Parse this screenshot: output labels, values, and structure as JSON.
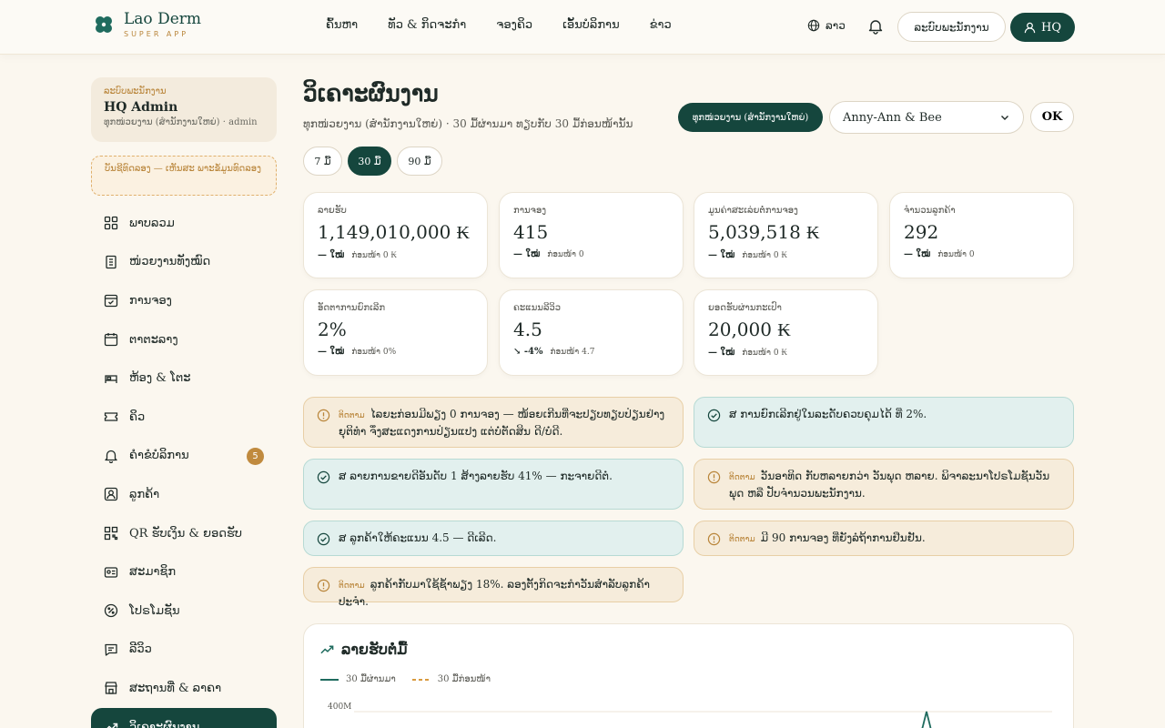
{
  "header": {
    "logo_name": "Lao Derm",
    "logo_sub": "SUPER APP",
    "nav": [
      "ຄົ້ນຫາ",
      "ທັວ & ກິດຈະກຳ",
      "ຈອງຄິວ",
      "ເອັ້ນບໍລິການ",
      "ຂ່າວ"
    ],
    "lang": "ລາວ",
    "staff_btn": "ລະບົບພະນັກງານ",
    "hq_btn": "HQ"
  },
  "sidebar": {
    "role": "ລະບົບພະນັກງານ",
    "name": "HQ Admin",
    "meta": "ທຸກໜ່ວຍງານ (ສຳນັກງານໃຫຍ່) · admin",
    "note": "ບັນຊີທົດລອງ — ເຫັນສະ ພາະຂໍ້ມູນທົດລອງ",
    "items": [
      {
        "label": "ພາບລວມ",
        "icon": "grid-icon"
      },
      {
        "label": "ໜ່ວຍງານທັງໝົດ",
        "icon": "building-icon"
      },
      {
        "label": "ການຈອງ",
        "icon": "calendar-check-icon"
      },
      {
        "label": "ຕາຕະລາງ",
        "icon": "calendar-icon"
      },
      {
        "label": "ຫ້ອງ & ໂຕະ",
        "icon": "bed-icon"
      },
      {
        "label": "ຄິວ",
        "icon": "ticket-icon"
      },
      {
        "label": "ຄຳຂໍບໍລິການ",
        "icon": "bell-icon",
        "badge": "5"
      },
      {
        "label": "ລູກຄ້າ",
        "icon": "user-square-icon"
      },
      {
        "label": "QR ຮັບເງິນ & ຍອດຮັບ",
        "icon": "qr-icon"
      },
      {
        "label": "ສະມາຊິກ",
        "icon": "id-card-icon"
      },
      {
        "label": "ໂປຣໂມຊັນ",
        "icon": "percent-icon"
      },
      {
        "label": "ລີວິວ",
        "icon": "message-icon"
      },
      {
        "label": "ສະຖານທີ່ & ລາຄາ",
        "icon": "store-icon"
      },
      {
        "label": "ວິເຄາະຜົນງານ",
        "icon": "trend-icon",
        "active": true
      }
    ]
  },
  "main": {
    "title": "ວິເຄາະຜົນງານ",
    "subtitle": "ທຸກໜ່ວຍງານ (ສຳນັກງານໃຫຍ່) · 30 ມື້ຜ່ານມາ ທຽບກັບ 30 ມື້ກ່ອນໜ້ານັ້ນ",
    "scope_pill": "ທຸກໜ່ວຍງານ (ສຳນັກງານໃຫຍ່)",
    "select_value": "Anny-Ann & Bee",
    "ok": "OK",
    "ranges": [
      "7 ມື້",
      "30 ມື້",
      "90 ມື້"
    ],
    "kpis": [
      {
        "label": "ລາຍຮັບ",
        "value": "1,149,010,000 ₭",
        "delta": "— ໃໝ່",
        "prev": "ກ່ອນໜ້າ 0 ₭"
      },
      {
        "label": "ການຈອງ",
        "value": "415",
        "delta": "— ໃໝ່",
        "prev": "ກ່ອນໜ້າ 0"
      },
      {
        "label": "ມູນຄ່າສະເລ່ຍຕໍ່ການຈອງ",
        "value": "5,039,518 ₭",
        "delta": "— ໃໝ່",
        "prev": "ກ່ອນໜ້າ 0 ₭"
      },
      {
        "label": "ຈຳນວນລູກຄ້າ",
        "value": "292",
        "delta": "— ໃໝ່",
        "prev": "ກ່ອນໜ້າ 0"
      },
      {
        "label": "ອັດຕາການຍົກເລີກ",
        "value": "2%",
        "delta": "— ໃໝ່",
        "prev": "ກ່ອນໜ້າ 0%"
      },
      {
        "label": "ຄະແນນລີວິວ",
        "value": "4.5",
        "delta": "↘ -4%",
        "prev": "ກ່ອນໜ້າ 4.7"
      },
      {
        "label": "ຍອດຮັບຜ່ານກະເປົາ",
        "value": "20,000 ₭",
        "delta": "— ໃໝ່",
        "prev": "ກ່ອນໜ້າ 0 ₭"
      }
    ],
    "alerts": [
      {
        "kind": "warn",
        "tag": "ຕິດຕາມ",
        "text": "ໄລຍະກ່ອນມີພຽງ 0 ການຈອງ — ໜ້ອຍເກີນທີ່ຈະປຽບທຽບປ່ຽນຢ່າງຍຸຕິທຳ ຈຶ່ງສະແດງການປ່ຽນແປງ ແຕ່ບໍ່ຕັດສິນ ດີ/ບໍ່ດີ."
      },
      {
        "kind": "ok",
        "tag": "",
        "text": "ສ ການຍົກເລີກຢູ່ໃນລະດັບຄວບຄຸມໄດ້ ທີ່ 2%."
      },
      {
        "kind": "ok",
        "tag": "",
        "text": "ສ ລາຍການຂາຍດີອັນດັບ 1 ສ້າງລາຍຮັບ 41% — ກະຈາຍດີຕໍ່."
      },
      {
        "kind": "warn",
        "tag": "ຕິດຕາມ",
        "text": "ວັນອາທິດ ກັບຫລາຍກວ່າ ວັນພຸດ ຫລາຍ. ພິຈາລະນາໂປຣໂມຊັນວັນພຸດ ຫລື ປັບຈຳນວນພະນັກງານ."
      },
      {
        "kind": "ok",
        "tag": "",
        "text": "ສ ລູກຄ້າໃຫ້ຄະແນນ 4.5 — ດີເລີດ."
      },
      {
        "kind": "warn",
        "tag": "ຕິດຕາມ",
        "text": "ມີ 90 ການຈອງ ທີ່ຍັງລໍຖ້າການຢືນຢັນ."
      },
      {
        "kind": "warn",
        "tag": "ຕິດຕາມ",
        "text": "ລູກຄ້າກັບມາໃຊ້ຊ້ຳພຽງ 18%. ລອງຕັ້ງກິດຈະກຳວັນສຳລັບລູກຄ້າປະຈຳ."
      }
    ],
    "chart": {
      "title": "ລາຍຮັບຕໍ່ມື້",
      "legend_current": "30 ມື້ຜ່ານມາ",
      "legend_previous": "30 ມື້ກ່ອນໜ້າ",
      "y_tick": "400M",
      "current_color": "#1f6b5e",
      "previous_color": "#d99a3f"
    }
  }
}
